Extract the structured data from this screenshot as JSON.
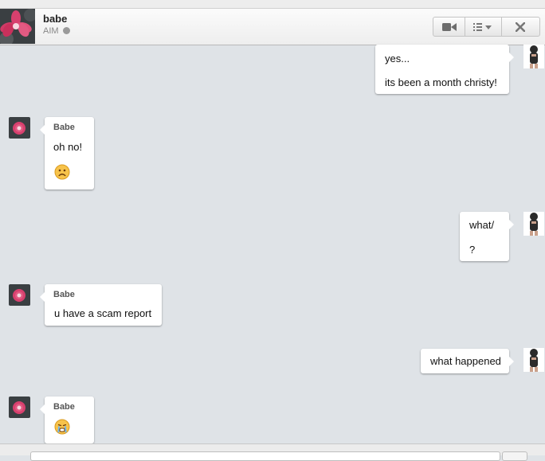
{
  "header": {
    "contact_name": "babe",
    "service": "AIM",
    "avatar_icon": "flower-avatar-icon",
    "toolbar": {
      "video_icon": "video-camera-icon",
      "menu_icon": "list-menu-icon",
      "close_icon": "close-icon"
    }
  },
  "messages": {
    "m1": {
      "from": "me",
      "lines": [
        "yes...",
        "its been a month christy!"
      ]
    },
    "m2": {
      "from": "Babe",
      "sender": "Babe",
      "lines": [
        "oh no!"
      ],
      "emoji": "sad-face-emoji"
    },
    "m3": {
      "from": "me",
      "lines": [
        "what/",
        "?"
      ]
    },
    "m4": {
      "from": "Babe",
      "sender": "Babe",
      "lines": [
        "u have a scam report"
      ]
    },
    "m5": {
      "from": "me",
      "lines": [
        "what happened"
      ]
    },
    "m6": {
      "from": "Babe",
      "sender": "Babe",
      "lines": [],
      "emoji": "crying-face-emoji"
    }
  },
  "colors": {
    "background": "#dfe3e7",
    "bubble": "#ffffff",
    "sender": "#555555"
  }
}
